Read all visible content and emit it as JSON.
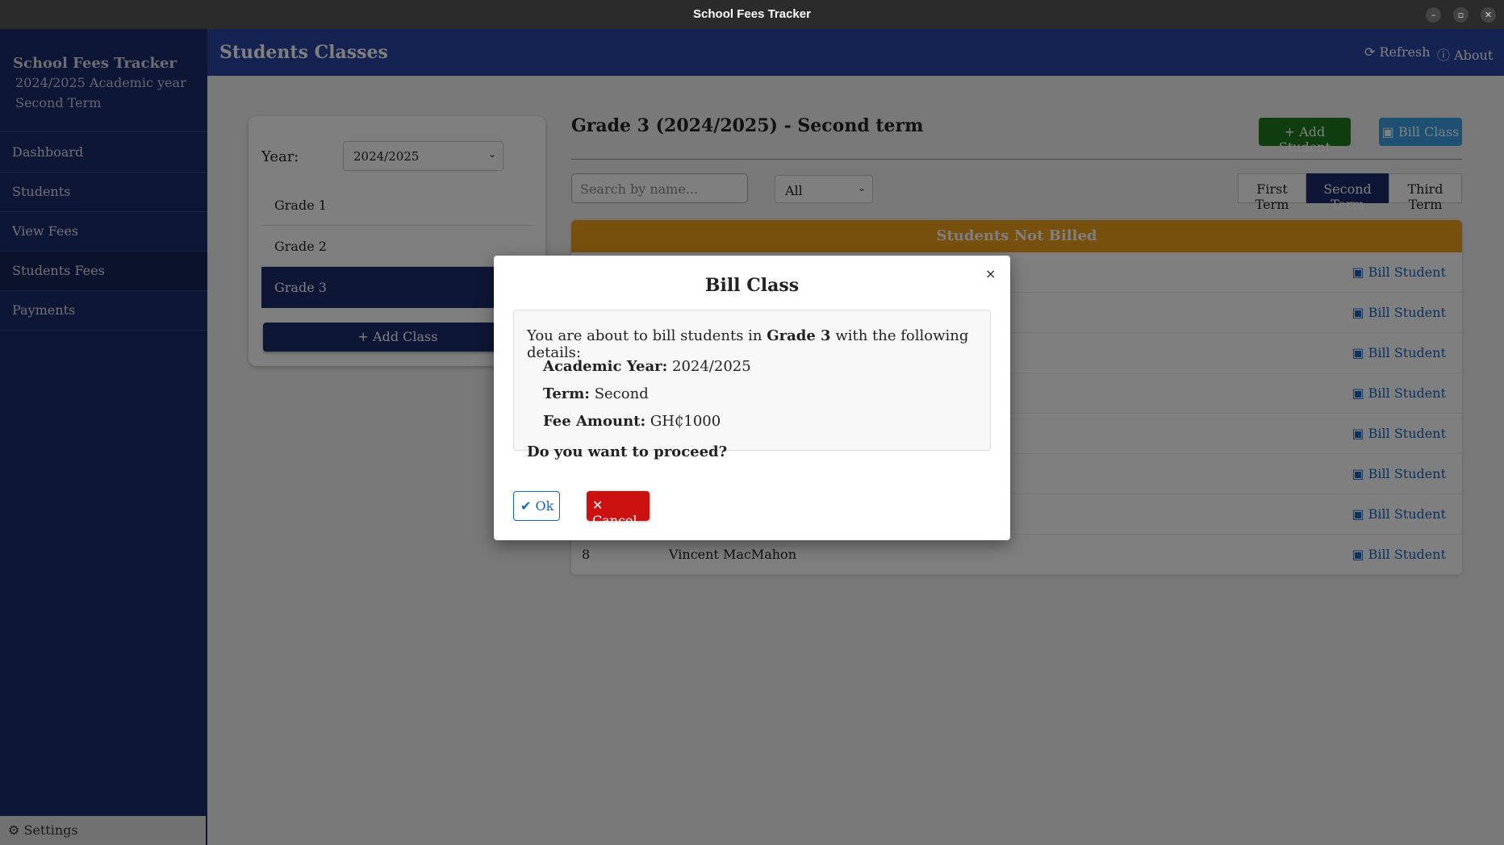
{
  "window": {
    "title": "School Fees Tracker",
    "controls": [
      "–",
      "▫",
      "✕"
    ]
  },
  "sidebar": {
    "app_name": "School Fees Tracker",
    "academic_year": "2024/2025 Academic year",
    "term": "Second Term",
    "items": [
      {
        "label": "Dashboard"
      },
      {
        "label": "Students"
      },
      {
        "label": "View Fees"
      },
      {
        "label": "Students Fees",
        "active": true
      },
      {
        "label": "Payments"
      }
    ],
    "settings_label": "Settings"
  },
  "header": {
    "title": "Students Classes",
    "refresh_label": "Refresh",
    "about_label": "About"
  },
  "class_panel": {
    "year_label": "Year:",
    "year_value": "2024/2025",
    "classes": [
      {
        "label": "Grade 1"
      },
      {
        "label": "Grade 2"
      },
      {
        "label": "Grade 3",
        "active": true
      }
    ],
    "add_class_label": "Add Class"
  },
  "main": {
    "title": "Grade 3 (2024/2025) - Second term",
    "add_student_label": "Add Student",
    "bill_class_label": "Bill Class",
    "search_placeholder": "Search by name...",
    "filter_value": "All",
    "terms": [
      {
        "label": "First Term"
      },
      {
        "label": "Second Term",
        "active": true
      },
      {
        "label": "Third Term"
      }
    ],
    "table_header": "Students Not Billed",
    "bill_student_label": "Bill Student",
    "rows": [
      {
        "num": "",
        "name": ""
      },
      {
        "num": "",
        "name": ""
      },
      {
        "num": "",
        "name": ""
      },
      {
        "num": "",
        "name": ""
      },
      {
        "num": "",
        "name": ""
      },
      {
        "num": "",
        "name": ""
      },
      {
        "num": "",
        "name": ""
      },
      {
        "num": "8",
        "name": "Vincent MacMahon"
      }
    ]
  },
  "modal": {
    "title": "Bill Class",
    "close": "×",
    "intro_prefix": "You are about to bill students in",
    "intro_class": "Grade 3",
    "intro_suffix": "with the following details:",
    "academic_year_label": "Academic Year:",
    "academic_year_value": "2024/2025",
    "term_label": "Term:",
    "term_value": "Second",
    "fee_label": "Fee Amount:",
    "fee_value": "GH₵1000",
    "question": "Do you want to proceed?",
    "ok_label": "Ok",
    "cancel_label": "Cancel"
  },
  "colors": {
    "sidebar": "#1c2d6b",
    "header": "#2a47a4",
    "table_header": "#f0a01c",
    "add_student": "#1e7a1e",
    "bill_class": "#3aa0e6",
    "cancel": "#cc1111",
    "link": "#1565c0"
  },
  "icons": {
    "refresh": "refresh-icon",
    "about": "info-icon",
    "add": "plus-icon",
    "bill": "money-icon",
    "settings": "gear-icon",
    "ok": "check-circle-icon",
    "cancel": "x-icon"
  }
}
